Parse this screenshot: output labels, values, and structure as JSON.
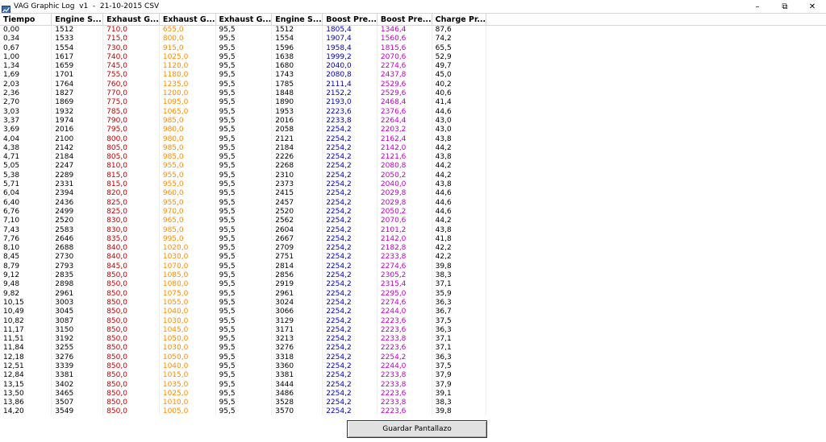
{
  "window": {
    "title": "VAG Graphic Log  v1  -  21-10-2015 CSV",
    "minimize_glyph": "–",
    "maximize_glyph": "⧉",
    "close_glyph": "✕"
  },
  "colors": {
    "black": "#000000",
    "red": "#c00000",
    "orange": "#ff8c00",
    "blue": "#0000c0",
    "magenta": "#c000c0"
  },
  "table": {
    "columns": [
      {
        "label": "Tiempo",
        "color": "black"
      },
      {
        "label": "Engine S...",
        "color": "black"
      },
      {
        "label": "Exhaust G...",
        "color": "red"
      },
      {
        "label": "Exhaust G...",
        "color": "orange"
      },
      {
        "label": "Exhaust G...",
        "color": "black"
      },
      {
        "label": "Engine S...",
        "color": "black"
      },
      {
        "label": "Boost Pre...",
        "color": "blue"
      },
      {
        "label": "Boost Pre...",
        "color": "magenta"
      },
      {
        "label": "Charge Pr...",
        "color": "black"
      }
    ],
    "rows": [
      [
        "0,00",
        "1512",
        "710,0",
        "655,0",
        "95,5",
        "1512",
        "1805,4",
        "1346,4",
        "87,6"
      ],
      [
        "0,34",
        "1533",
        "715,0",
        "800,0",
        "95,5",
        "1554",
        "1907,4",
        "1560,6",
        "74,2"
      ],
      [
        "0,67",
        "1554",
        "730,0",
        "915,0",
        "95,5",
        "1596",
        "1958,4",
        "1815,6",
        "65,5"
      ],
      [
        "1,00",
        "1617",
        "740,0",
        "1025,0",
        "95,5",
        "1638",
        "1999,2",
        "2070,6",
        "52,9"
      ],
      [
        "1,34",
        "1659",
        "745,0",
        "1120,0",
        "95,5",
        "1680",
        "2040,0",
        "2274,6",
        "49,7"
      ],
      [
        "1,69",
        "1701",
        "755,0",
        "1180,0",
        "95,5",
        "1743",
        "2080,8",
        "2437,8",
        "45,0"
      ],
      [
        "2,03",
        "1764",
        "760,0",
        "1235,0",
        "95,5",
        "1785",
        "2111,4",
        "2529,6",
        "40,2"
      ],
      [
        "2,36",
        "1827",
        "770,0",
        "1200,0",
        "95,5",
        "1848",
        "2152,2",
        "2529,6",
        "40,6"
      ],
      [
        "2,70",
        "1869",
        "775,0",
        "1095,0",
        "95,5",
        "1890",
        "2193,0",
        "2468,4",
        "41,4"
      ],
      [
        "3,03",
        "1932",
        "785,0",
        "1065,0",
        "95,5",
        "1953",
        "2223,6",
        "2376,6",
        "44,6"
      ],
      [
        "3,37",
        "1974",
        "790,0",
        "985,0",
        "95,5",
        "2016",
        "2233,8",
        "2264,4",
        "43,0"
      ],
      [
        "3,69",
        "2016",
        "795,0",
        "980,0",
        "95,5",
        "2058",
        "2254,2",
        "2203,2",
        "43,0"
      ],
      [
        "4,04",
        "2100",
        "800,0",
        "980,0",
        "95,5",
        "2121",
        "2254,2",
        "2162,4",
        "43,8"
      ],
      [
        "4,38",
        "2142",
        "805,0",
        "985,0",
        "95,5",
        "2184",
        "2254,2",
        "2142,0",
        "44,2"
      ],
      [
        "4,71",
        "2184",
        "805,0",
        "985,0",
        "95,5",
        "2226",
        "2254,2",
        "2121,6",
        "43,8"
      ],
      [
        "5,05",
        "2247",
        "810,0",
        "955,0",
        "95,5",
        "2268",
        "2254,2",
        "2080,8",
        "44,2"
      ],
      [
        "5,38",
        "2289",
        "815,0",
        "955,0",
        "95,5",
        "2310",
        "2254,2",
        "2050,2",
        "44,2"
      ],
      [
        "5,71",
        "2331",
        "815,0",
        "955,0",
        "95,5",
        "2373",
        "2254,2",
        "2040,0",
        "43,8"
      ],
      [
        "6,04",
        "2394",
        "820,0",
        "960,0",
        "95,5",
        "2415",
        "2254,2",
        "2029,8",
        "44,6"
      ],
      [
        "6,40",
        "2436",
        "825,0",
        "955,0",
        "95,5",
        "2457",
        "2254,2",
        "2029,8",
        "44,6"
      ],
      [
        "6,76",
        "2499",
        "825,0",
        "970,0",
        "95,5",
        "2520",
        "2254,2",
        "2050,2",
        "44,6"
      ],
      [
        "7,10",
        "2520",
        "830,0",
        "965,0",
        "95,5",
        "2562",
        "2254,2",
        "2070,6",
        "44,2"
      ],
      [
        "7,43",
        "2583",
        "830,0",
        "985,0",
        "95,5",
        "2604",
        "2254,2",
        "2101,2",
        "43,8"
      ],
      [
        "7,76",
        "2646",
        "835,0",
        "995,0",
        "95,5",
        "2667",
        "2254,2",
        "2142,0",
        "41,8"
      ],
      [
        "8,10",
        "2688",
        "840,0",
        "1020,0",
        "95,5",
        "2709",
        "2254,2",
        "2182,8",
        "42,2"
      ],
      [
        "8,45",
        "2730",
        "840,0",
        "1030,0",
        "95,5",
        "2751",
        "2254,2",
        "2233,8",
        "42,2"
      ],
      [
        "8,79",
        "2793",
        "845,0",
        "1070,0",
        "95,5",
        "2814",
        "2254,2",
        "2274,6",
        "39,8"
      ],
      [
        "9,12",
        "2835",
        "850,0",
        "1085,0",
        "95,5",
        "2856",
        "2254,2",
        "2305,2",
        "38,3"
      ],
      [
        "9,48",
        "2898",
        "850,0",
        "1080,0",
        "95,5",
        "2919",
        "2254,2",
        "2315,4",
        "37,1"
      ],
      [
        "9,82",
        "2961",
        "850,0",
        "1075,0",
        "95,5",
        "2961",
        "2254,2",
        "2295,0",
        "35,9"
      ],
      [
        "10,15",
        "3003",
        "850,0",
        "1055,0",
        "95,5",
        "3024",
        "2254,2",
        "2274,6",
        "36,3"
      ],
      [
        "10,49",
        "3045",
        "850,0",
        "1040,0",
        "95,5",
        "3066",
        "2254,2",
        "2244,0",
        "36,7"
      ],
      [
        "10,82",
        "3087",
        "850,0",
        "1030,0",
        "95,5",
        "3129",
        "2254,2",
        "2223,6",
        "37,5"
      ],
      [
        "11,17",
        "3150",
        "850,0",
        "1045,0",
        "95,5",
        "3171",
        "2254,2",
        "2223,6",
        "36,3"
      ],
      [
        "11,51",
        "3192",
        "850,0",
        "1050,0",
        "95,5",
        "3213",
        "2254,2",
        "2233,8",
        "37,1"
      ],
      [
        "11,84",
        "3255",
        "850,0",
        "1030,0",
        "95,5",
        "3276",
        "2254,2",
        "2223,6",
        "37,1"
      ],
      [
        "12,18",
        "3276",
        "850,0",
        "1050,0",
        "95,5",
        "3318",
        "2254,2",
        "2254,2",
        "36,3"
      ],
      [
        "12,51",
        "3339",
        "850,0",
        "1040,0",
        "95,5",
        "3360",
        "2254,2",
        "2244,0",
        "37,5"
      ],
      [
        "12,84",
        "3381",
        "850,0",
        "1015,0",
        "95,5",
        "3381",
        "2254,2",
        "2233,8",
        "37,9"
      ],
      [
        "13,15",
        "3402",
        "850,0",
        "1035,0",
        "95,5",
        "3444",
        "2254,2",
        "2233,8",
        "37,9"
      ],
      [
        "13,50",
        "3465",
        "850,0",
        "1025,0",
        "95,5",
        "3486",
        "2254,2",
        "2223,6",
        "39,1"
      ],
      [
        "13,86",
        "3507",
        "850,0",
        "1010,0",
        "95,5",
        "3528",
        "2254,2",
        "2233,8",
        "38,3"
      ],
      [
        "14,20",
        "3549",
        "850,0",
        "1005,0",
        "95,5",
        "3570",
        "2254,2",
        "2223,6",
        "39,8"
      ]
    ]
  },
  "footer": {
    "save_label": "Guardar Pantallazo"
  }
}
